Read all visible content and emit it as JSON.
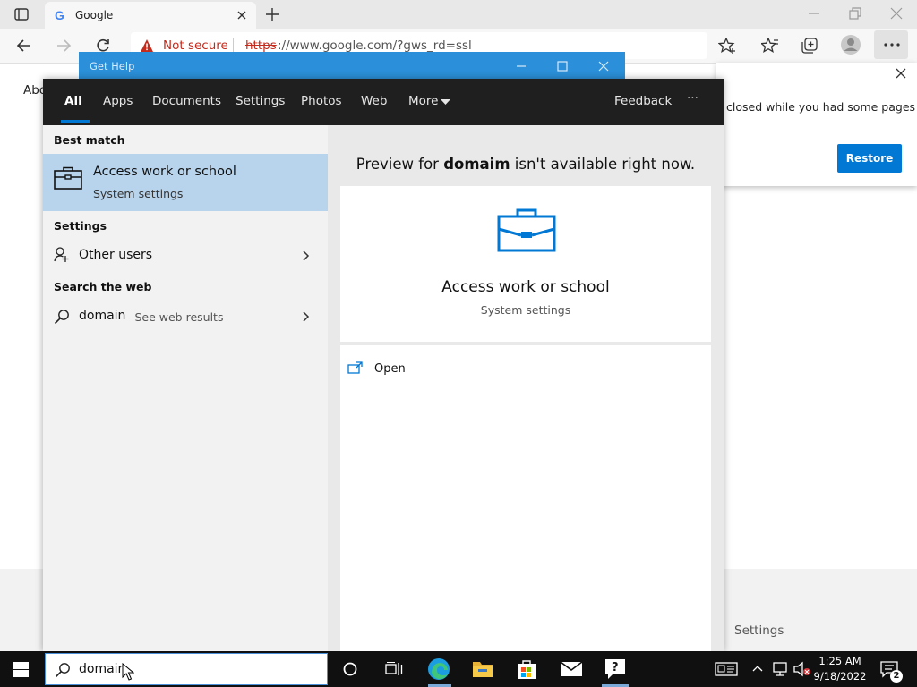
{
  "browser": {
    "tab_title": "Google",
    "not_secure": "Not secure",
    "url_scheme": "https",
    "url_rest": "://www.google.com/?gws_rd=ssl"
  },
  "background_page": {
    "about_text": "Abo",
    "restore_message": "closed while you had some pages",
    "restore_button": "Restore",
    "footer_settings": "Settings"
  },
  "get_help": {
    "title": "Get Help"
  },
  "search": {
    "tabs": [
      "All",
      "Apps",
      "Documents",
      "Settings",
      "Photos",
      "Web",
      "More"
    ],
    "feedback": "Feedback",
    "ellipsis": "···",
    "best_match_heading": "Best match",
    "best_match": {
      "title": "Access work or school",
      "subtitle": "System settings"
    },
    "settings_heading": "Settings",
    "other_users": "Other users",
    "web_heading": "Search the web",
    "web_query": "domain",
    "web_suffix": "- See web results",
    "preview_prefix": "Preview for ",
    "preview_term": "domaim",
    "preview_suffix": " isn't available right now.",
    "card_title": "Access work or school",
    "card_subtitle": "System settings",
    "open_label": "Open",
    "input_value": "domain"
  },
  "taskbar": {
    "time": "1:25 AM",
    "date": "9/18/2022",
    "notification_count": "2"
  },
  "colors": {
    "accent": "#0078d4",
    "selection": "#b8d4ed",
    "search_header": "#1f1f1f",
    "gethelp_bar": "#2b90d9",
    "warning_red": "#c42b1c"
  }
}
